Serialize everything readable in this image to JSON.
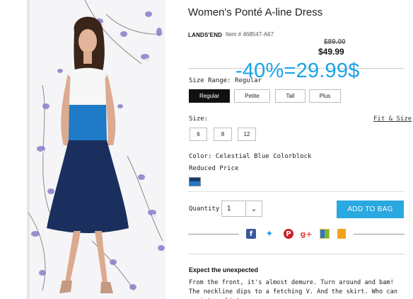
{
  "product": {
    "title": "Women's Ponté A-line Dress",
    "brand": "LANDS'END",
    "item_number": "Item # 468547-A67",
    "price_original": "$89.00",
    "price_current": "$49.99",
    "discount_overlay": "-40%=29.99$"
  },
  "size_range": {
    "label": "Size Range: Regular",
    "options": [
      "Regular",
      "Petite",
      "Tall",
      "Plus"
    ],
    "selected": "Regular"
  },
  "size": {
    "label": "Size:",
    "fit_link": "Fit & Size",
    "options": [
      "6",
      "8",
      "12"
    ]
  },
  "color": {
    "label": "Color: Celestial Blue Colorblock",
    "status": "Reduced Price"
  },
  "quantity": {
    "label": "Quantity",
    "value": "1"
  },
  "add_to_bag": "ADD TO BAG",
  "social": {
    "icons": [
      "facebook-icon",
      "twitter-icon",
      "pinterest-icon",
      "google-plus-icon",
      "delicious-icon",
      "bookmark-icon"
    ],
    "glyphs": [
      "f",
      "t",
      "P",
      "g+",
      "",
      ""
    ],
    "colors": [
      "#3b5998",
      "#1da1f2",
      "#cb2027",
      "#dd4b39",
      "#7ab734",
      "#f4a21d"
    ]
  },
  "description": {
    "heading": "Expect the unexpected",
    "text": "From the front, it's almost demure. Turn around and bam! The neckline dips to a fetching V. And the skirt. Who can resist a skirt"
  },
  "colors": {
    "accent": "#2aa8e0",
    "discount_text": "#1aa3e8",
    "dress_top": "#1f7ac8",
    "dress_bottom": "#1a2f5e"
  }
}
